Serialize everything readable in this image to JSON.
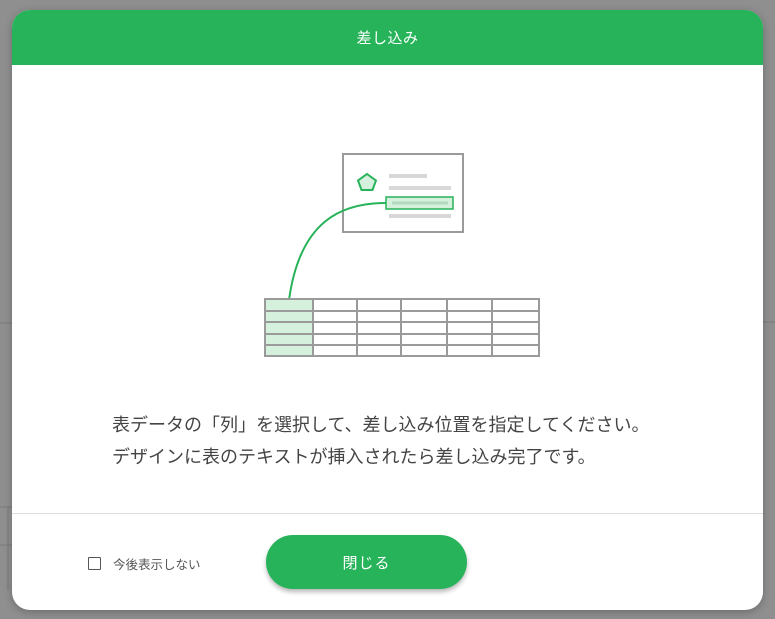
{
  "dialog": {
    "title": "差し込み",
    "description_line1": "表データの「列」を選択して、差し込み位置を指定してください。",
    "description_line2": "デザインに表のテキストが挿入されたら差し込み完了です。",
    "dont_show_label": "今後表示しない",
    "dont_show_checked": false,
    "close_label": "閉じる"
  },
  "colors": {
    "accent": "#27b35a",
    "accent_light": "#d5f0dd",
    "overlay": "#8f8f8f",
    "text": "#444444",
    "illustration_gray": "#9a9a9a"
  },
  "icons": {
    "pentagon": "pentagon-icon",
    "checkbox": "checkbox-icon"
  }
}
